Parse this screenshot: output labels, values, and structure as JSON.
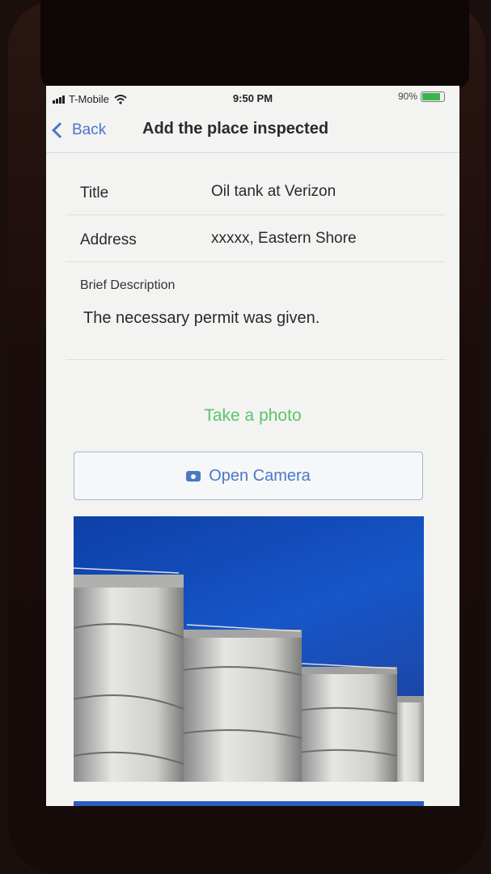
{
  "status": {
    "carrier": "T-Mobile",
    "time": "9:50 PM",
    "battery": "90%",
    "battery_level": 0.9
  },
  "nav": {
    "back_label": "Back",
    "title": "Add the place inspected"
  },
  "form": {
    "title_label": "Title",
    "title_value": "Oil tank at Verizon",
    "address_label": "Address",
    "address_value": "xxxxx, Eastern Shore",
    "desc_label": "Brief Description",
    "desc_value": "The necessary permit was given."
  },
  "photo": {
    "take_label": "Take a photo",
    "open_camera_label": "Open Camera"
  },
  "colors": {
    "accent": "#4a78c8",
    "green": "#5cc46a"
  },
  "icons": [
    "signal-icon",
    "wifi-icon",
    "battery-icon",
    "chevron-left-icon",
    "camera-icon"
  ]
}
